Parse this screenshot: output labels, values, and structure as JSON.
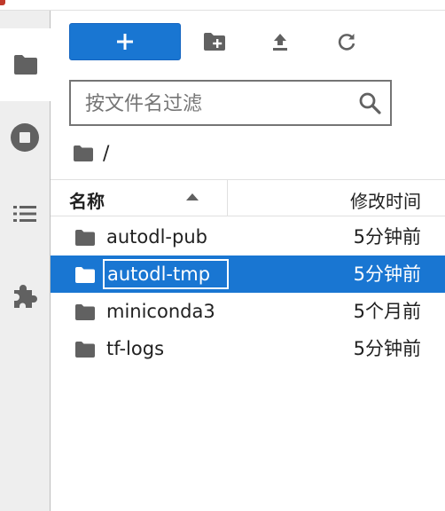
{
  "colors": {
    "accent": "#1976d2",
    "folder": "#616161",
    "icon": "#616161"
  },
  "activity_bar": {
    "tabs": [
      {
        "icon": "folder-icon",
        "active": true
      },
      {
        "icon": "stop-circle-icon",
        "active": false
      },
      {
        "icon": "list-icon",
        "active": false
      },
      {
        "icon": "puzzle-icon",
        "active": false
      }
    ]
  },
  "toolbar": {
    "new_label": "+",
    "icons": [
      "new-folder-icon",
      "upload-icon",
      "refresh-icon"
    ]
  },
  "filter": {
    "placeholder": "按文件名过滤",
    "value": ""
  },
  "breadcrumb": {
    "separator": "/"
  },
  "list_header": {
    "name": "名称",
    "modified": "修改时间"
  },
  "files": [
    {
      "name": "autodl-pub",
      "modified": "5分钟前",
      "selected": false,
      "editing": false
    },
    {
      "name": "autodl-tmp",
      "modified": "5分钟前",
      "selected": true,
      "editing": true
    },
    {
      "name": "miniconda3",
      "modified": "5个月前",
      "selected": false,
      "editing": false
    },
    {
      "name": "tf-logs",
      "modified": "5分钟前",
      "selected": false,
      "editing": false
    }
  ]
}
